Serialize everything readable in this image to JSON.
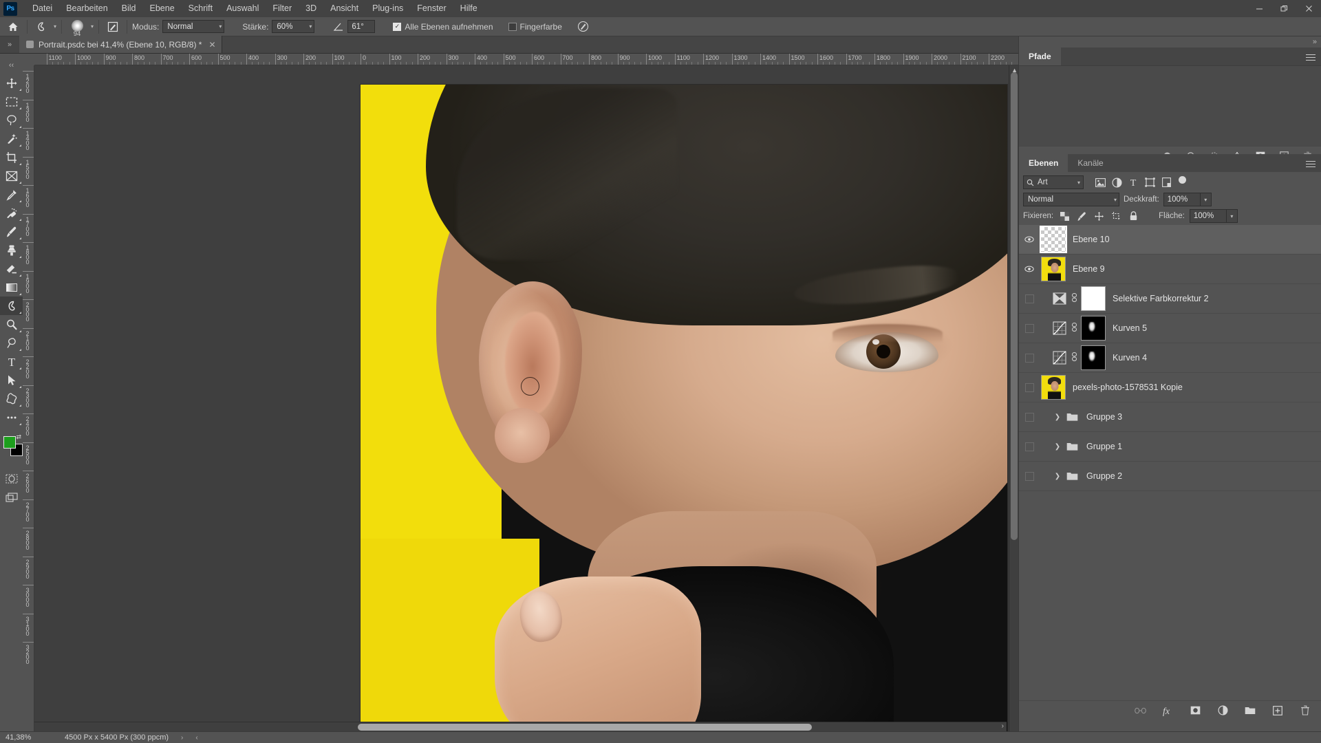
{
  "app": {
    "logo": "Ps",
    "menus": [
      "Datei",
      "Bearbeiten",
      "Bild",
      "Ebene",
      "Schrift",
      "Auswahl",
      "Filter",
      "3D",
      "Ansicht",
      "Plug-ins",
      "Fenster",
      "Hilfe"
    ],
    "window_controls": {
      "minimize": "—",
      "restore": "❐",
      "close": "✕"
    }
  },
  "options_bar": {
    "home_icon": "home-icon",
    "tool_icon": "smudge-tool-icon",
    "brush_size": "94",
    "brush_preset_caret": "⌄",
    "brush_panel_icon": "brush-settings-icon",
    "mode_label": "Modus:",
    "mode_value": "Normal",
    "strength_label": "Stärke:",
    "strength_value": "60%",
    "angle_label": "angle-icon",
    "angle_value": "61°",
    "sample_all_layers": {
      "label": "Alle Ebenen aufnehmen",
      "checked": true
    },
    "finger_paint": {
      "label": "Fingerfarbe",
      "checked": false
    },
    "pressure_icon": "tablet-pressure-icon",
    "right_icons": [
      "share-collab-icon",
      "search-icon",
      "workspace-icon",
      "chevron-down-icon",
      "export-icon"
    ]
  },
  "tabbar": {
    "expander": "»",
    "document": {
      "title": "Portrait.psdc bei 41,4% (Ebene 10, RGB/8) *",
      "close": "✕"
    }
  },
  "toolbar": {
    "tools": [
      {
        "name": "move-tool",
        "glyph": "move"
      },
      {
        "name": "rectangular-marquee-tool",
        "glyph": "marquee"
      },
      {
        "name": "lasso-tool",
        "glyph": "lasso"
      },
      {
        "name": "magic-wand-tool",
        "glyph": "wand"
      },
      {
        "name": "crop-tool",
        "glyph": "crop"
      },
      {
        "name": "frame-tool",
        "glyph": "frame"
      },
      {
        "name": "eyedropper-tool",
        "glyph": "eyedropper"
      },
      {
        "name": "spot-healing-brush-tool",
        "glyph": "healing"
      },
      {
        "name": "brush-tool",
        "glyph": "brush"
      },
      {
        "name": "clone-stamp-tool",
        "glyph": "stamp"
      },
      {
        "name": "eraser-tool",
        "glyph": "eraser"
      },
      {
        "name": "gradient-tool",
        "glyph": "gradient"
      },
      {
        "name": "smudge-tool",
        "glyph": "smudge",
        "selected": true
      },
      {
        "name": "dodge-tool",
        "glyph": "dodge"
      },
      {
        "name": "pen-tool",
        "glyph": "pen"
      },
      {
        "name": "type-tool",
        "glyph": "type"
      },
      {
        "name": "path-selection-tool",
        "glyph": "arrow"
      },
      {
        "name": "custom-shape-tool",
        "glyph": "shape"
      },
      {
        "name": "more-tools",
        "glyph": "ellipsis"
      }
    ],
    "foreground_color": "#1d9e1d",
    "background_color": "#000000",
    "quick_mask": "quick-mask-icon",
    "screen_mode": "screen-mode-icon"
  },
  "rulers": {
    "horizontal": [
      "1100",
      "1000",
      "900",
      "800",
      "700",
      "600",
      "500",
      "400",
      "300",
      "200",
      "100",
      "0",
      "100",
      "200",
      "300",
      "400",
      "500",
      "600",
      "700",
      "800",
      "900",
      "1000",
      "1100",
      "1200",
      "1300",
      "1400",
      "1500",
      "1600",
      "1700",
      "1800",
      "1900",
      "2000",
      "2100",
      "2200"
    ],
    "vertical": [
      "1200",
      "1300",
      "1400",
      "1500",
      "1600",
      "1700",
      "1800",
      "1900",
      "2000",
      "2100",
      "2200",
      "2300",
      "2400",
      "2500",
      "2600",
      "2700",
      "2800",
      "2900",
      "3000",
      "3100",
      "3200"
    ]
  },
  "canvas": {
    "brush_cursor": "brush-cursor",
    "background_color": "#f2de0c"
  },
  "paths_panel": {
    "tab": "Pfade",
    "menu_icon": "panel-menu-icon",
    "footer_icons": [
      "fill-path-icon",
      "stroke-path-icon",
      "load-selection-icon",
      "make-work-path-icon",
      "add-mask-icon",
      "new-path-icon",
      "delete-path-icon"
    ]
  },
  "layers_panel": {
    "tabs": [
      {
        "label": "Ebenen",
        "active": true
      },
      {
        "label": "Kanäle",
        "active": false
      }
    ],
    "menu_icon": "panel-menu-icon",
    "filter": {
      "search_icon": "search-icon",
      "value": "Art",
      "caret": "⌄",
      "type_icons": [
        "pixel-filter-icon",
        "adjustment-filter-icon",
        "type-filter-icon",
        "shape-filter-icon",
        "smartobject-filter-icon"
      ],
      "toggle": "filter-toggle-icon"
    },
    "blend_mode": {
      "value": "Normal",
      "caret": "⌄"
    },
    "opacity": {
      "label": "Deckkraft:",
      "value": "100%",
      "caret": "⌄"
    },
    "lock": {
      "label": "Fixieren:",
      "icons": [
        "lock-transparency-icon",
        "lock-image-icon",
        "lock-position-icon",
        "lock-artboard-icon",
        "lock-all-icon"
      ]
    },
    "fill": {
      "label": "Fläche:",
      "value": "100%",
      "caret": "⌄"
    },
    "layers": [
      {
        "name": "Ebene 10",
        "visible": true,
        "selected": true,
        "thumb": "checker",
        "kind": "pixel"
      },
      {
        "name": "Ebene 9",
        "visible": true,
        "selected": false,
        "thumb": "portrait",
        "kind": "pixel"
      },
      {
        "name": "Selektive Farbkorrektur 2",
        "visible": false,
        "selected": false,
        "thumb": "white",
        "kind": "adjustment",
        "adj_icon": "selective-color-icon",
        "linked": true
      },
      {
        "name": "Kurven 5",
        "visible": false,
        "selected": false,
        "thumb": "black",
        "kind": "adjustment",
        "adj_icon": "curves-icon",
        "linked": true
      },
      {
        "name": "Kurven 4",
        "visible": false,
        "selected": false,
        "thumb": "black",
        "kind": "adjustment",
        "adj_icon": "curves-icon",
        "linked": true
      },
      {
        "name": "pexels-photo-1578531 Kopie",
        "visible": false,
        "selected": false,
        "thumb": "portrait",
        "kind": "pixel"
      },
      {
        "name": "Gruppe 3",
        "visible": false,
        "selected": false,
        "kind": "group"
      },
      {
        "name": "Gruppe 1",
        "visible": false,
        "selected": false,
        "kind": "group"
      },
      {
        "name": "Gruppe 2",
        "visible": false,
        "selected": false,
        "kind": "group"
      }
    ],
    "footer_icons": [
      "link-layers-icon",
      "layer-style-fx-icon",
      "add-mask-icon",
      "new-adjustment-layer-icon",
      "new-group-icon",
      "new-layer-icon",
      "delete-layer-icon"
    ]
  },
  "status_bar": {
    "zoom": "41,38%",
    "dimensions": "4500 Px x 5400 Px (300 ppcm)",
    "forward_arrow": "›",
    "back_arrow": "‹"
  }
}
